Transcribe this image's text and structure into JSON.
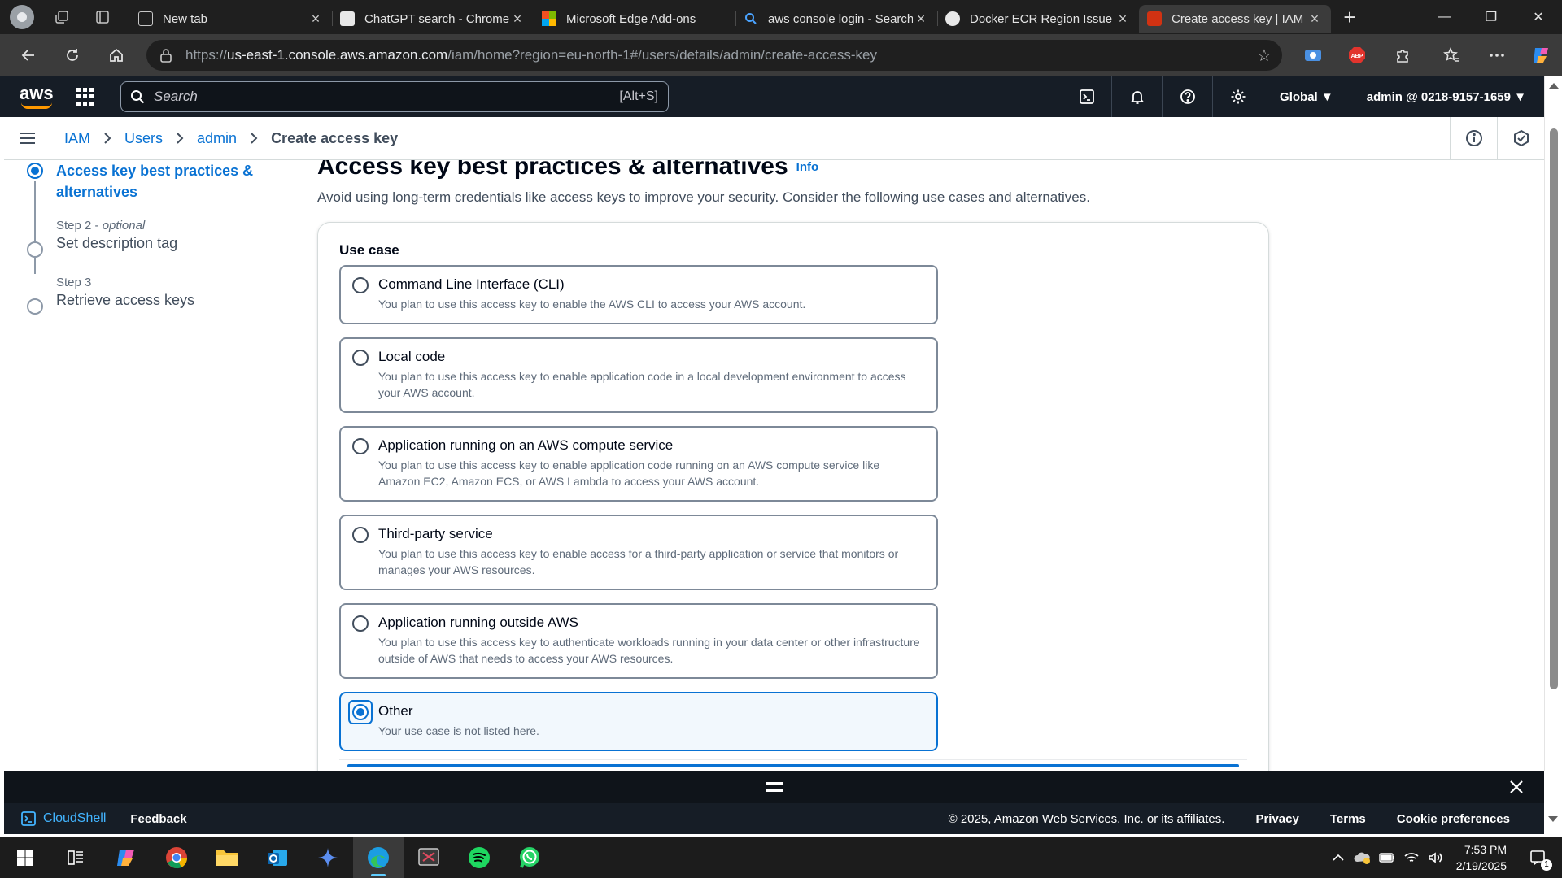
{
  "browser": {
    "tabs": [
      {
        "title": "New tab",
        "favicon_color": "#2b2b2b",
        "active": false
      },
      {
        "title": "ChatGPT search - Chrome",
        "favicon_color": "#e8e8e8",
        "active": false
      },
      {
        "title": "Microsoft Edge Add-ons",
        "favicon_color": "#f25022",
        "active": false
      },
      {
        "title": "aws console login - Search",
        "favicon_color": "#1f1f1f",
        "active": false
      },
      {
        "title": "Docker ECR Region Issue",
        "favicon_color": "#e8e8e8",
        "active": false
      },
      {
        "title": "Create access key | IAM | Global",
        "favicon_color": "#d13212",
        "active": true
      }
    ],
    "url_prefix": "https://",
    "url_host": "us-east-1.console.aws.amazon.com",
    "url_path": "/iam/home?region=eu-north-1#/users/details/admin/create-access-key"
  },
  "aws_nav": {
    "logo": "aws",
    "search_placeholder": "Search",
    "search_shortcut": "[Alt+S]",
    "region": "Global",
    "account": "admin @ 0218-9157-1659"
  },
  "breadcrumb": {
    "items": [
      "IAM",
      "Users",
      "admin"
    ],
    "current": "Create access key"
  },
  "wizard": {
    "steps": [
      {
        "number": "",
        "optional": "",
        "label": "Access key best practices & alternatives",
        "active": true
      },
      {
        "number": "Step 2",
        "optional": "optional",
        "label": "Set description tag",
        "active": false
      },
      {
        "number": "Step 3",
        "optional": "",
        "label": "Retrieve access keys",
        "active": false
      }
    ]
  },
  "page": {
    "title": "Access key best practices & alternatives",
    "info_link": "Info",
    "description": "Avoid using long-term credentials like access keys to improve your security. Consider the following use cases and alternatives.",
    "use_case_label": "Use case",
    "options": [
      {
        "title": "Command Line Interface (CLI)",
        "desc": "You plan to use this access key to enable the AWS CLI to access your AWS account.",
        "selected": false
      },
      {
        "title": "Local code",
        "desc": "You plan to use this access key to enable application code in a local development environment to access your AWS account.",
        "selected": false
      },
      {
        "title": "Application running on an AWS compute service",
        "desc": "You plan to use this access key to enable application code running on an AWS compute service like Amazon EC2, Amazon ECS, or AWS Lambda to access your AWS account.",
        "selected": false
      },
      {
        "title": "Third-party service",
        "desc": "You plan to use this access key to enable access for a third-party application or service that monitors or manages your AWS resources.",
        "selected": false
      },
      {
        "title": "Application running outside AWS",
        "desc": "You plan to use this access key to authenticate workloads running in your data center or other infrastructure outside of AWS that needs to access your AWS resources.",
        "selected": false
      },
      {
        "title": "Other",
        "desc": "Your use case is not listed here.",
        "selected": true
      }
    ]
  },
  "footer": {
    "cloudshell": "CloudShell",
    "feedback": "Feedback",
    "copyright": "© 2025, Amazon Web Services, Inc. or its affiliates.",
    "privacy": "Privacy",
    "terms": "Terms",
    "cookies": "Cookie preferences"
  },
  "taskbar": {
    "time": "7:53 PM",
    "date": "2/19/2025",
    "notification_count": "1"
  },
  "colors": {
    "aws_nav_bg": "#161d26",
    "link_blue": "#0972d3",
    "aws_orange": "#ff9900"
  }
}
